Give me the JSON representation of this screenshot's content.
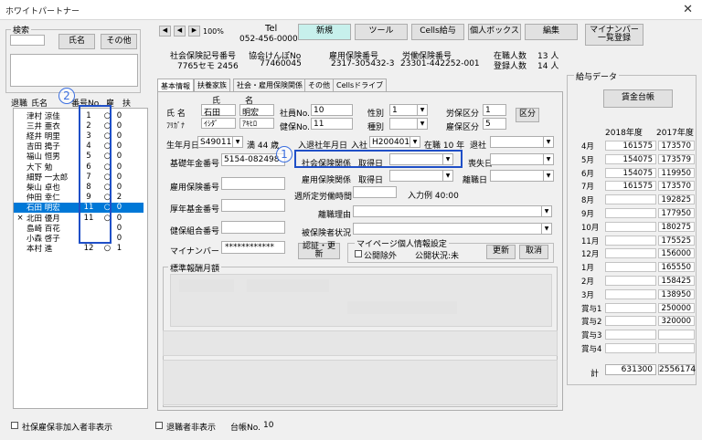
{
  "window": {
    "title": "ホワイトパートナー"
  },
  "search": {
    "label": "検索",
    "name_btn": "氏名",
    "other_btn": "その他"
  },
  "list": {
    "headers": [
      "退職",
      "氏名",
      "番号No.",
      "雇",
      "扶"
    ],
    "rows": [
      {
        "ret": "",
        "name": "津村 涼佳",
        "no": "1",
        "koyo": "○",
        "fu": "0"
      },
      {
        "ret": "",
        "name": "三井 亜衣",
        "no": "2",
        "koyo": "○",
        "fu": "0"
      },
      {
        "ret": "",
        "name": "経井 明里",
        "no": "3",
        "koyo": "○",
        "fu": "0"
      },
      {
        "ret": "",
        "name": "吉田 搗子",
        "no": "4",
        "koyo": "○",
        "fu": "0"
      },
      {
        "ret": "",
        "name": "福山 恒男",
        "no": "5",
        "koyo": "○",
        "fu": "0"
      },
      {
        "ret": "",
        "name": "大下 勉",
        "no": "6",
        "koyo": "○",
        "fu": "0"
      },
      {
        "ret": "",
        "name": "細野 一太郎",
        "no": "7",
        "koyo": "○",
        "fu": "0"
      },
      {
        "ret": "",
        "name": "柴山 卓也",
        "no": "8",
        "koyo": "○",
        "fu": "0"
      },
      {
        "ret": "",
        "name": "仲田 幸仁",
        "no": "9",
        "koyo": "○",
        "fu": "2"
      },
      {
        "ret": "",
        "name": "石田 明宏",
        "no": "11",
        "koyo": "○",
        "fu": "0"
      },
      {
        "ret": "×",
        "name": "北田 優月",
        "no": "11",
        "koyo": "○",
        "fu": "0"
      },
      {
        "ret": "",
        "name": "島崎 百花",
        "no": "",
        "koyo": "",
        "fu": "0"
      },
      {
        "ret": "",
        "name": "小森 啓子",
        "no": "",
        "koyo": "",
        "fu": "0"
      },
      {
        "ret": "",
        "name": "本村 進",
        "no": "12",
        "koyo": "○",
        "fu": "1"
      }
    ],
    "selected_index": 9
  },
  "bottom": {
    "hide_label": "社保雇保非加入者非表示",
    "retiree_label": "退職者非表示",
    "count_label": "台帳No.",
    "count_value": "10"
  },
  "nav": {
    "zoom": "100%",
    "tel_label": "Tel",
    "tel": "052-456-0000"
  },
  "toolbar": {
    "new": "新規",
    "tool": "ツール",
    "cells_pay": "Cells給与",
    "personal_box": "個人ボックス",
    "edit": "編集",
    "mynumber": "マイナンバー\n一覧登録"
  },
  "company": {
    "shakai_label": "社会保険記号番号",
    "shakai": "7765セモ 2456",
    "kenpo_label": "協会けんぽNo",
    "kenpo": "77460045",
    "koyo_label": "雇用保険番号",
    "koyo": "2317-305432-3",
    "rodo_label": "労働保険番号",
    "rodo": "23301-442252-001",
    "zaishoku_label": "在職人数",
    "zaishoku": "13 人",
    "toroku_label": "登録人数",
    "toroku": "14 人"
  },
  "tabs": [
    "基本情報",
    "扶養家族",
    "社会・雇用保険関係",
    "その他",
    "Cellsドライブ"
  ],
  "form": {
    "shi": "氏",
    "mei": "名",
    "name_label": "氏 名",
    "last": "石田",
    "first": "明宏",
    "kana_label": "ﾌﾘｶﾞﾅ",
    "last_kana": "ｲｼﾀﾞ",
    "first_kana": "ｱｷﾋﾛ",
    "empno_label": "社員No.",
    "empno": "10",
    "kenpono_label": "健保No.",
    "kenpono": "11",
    "sex_label": "性別",
    "sex": "1",
    "shubetsu_label": "種別",
    "shubetsu": "",
    "rodo_kubun_label": "労保区分",
    "rodo_kubun": "1",
    "koyo_kubun_label": "雇保区分",
    "koyo_kubun": "5",
    "kubun_btn": "区分",
    "birth_label": "生年月日",
    "birth": "S490110",
    "age": "満 44 歳",
    "join_label": "入退社年月日",
    "join_sub": "入社",
    "join": "H200401",
    "tenure": "在職 10 年",
    "taisha_label": "退社",
    "kiso_label": "基礎年金番号",
    "kiso": "5154-082498",
    "shakai_rel_label": "社会保険関係",
    "shutoku": "取得日",
    "soshitsu": "喪失日",
    "koyo_rel_label": "雇用保険関係",
    "shutoku2": "取得日",
    "rishoku": "離職日",
    "koyo_no_label": "雇用保険番号",
    "kosei_label": "厚年基金番号",
    "weekly_label": "週所定労働時間",
    "input_ex": "入力例 40:00",
    "rishoku_reason_label": "離職理由",
    "hihoken_label": "被保険者状況",
    "kenpo_kumiai_label": "健保組合番号",
    "mynumber_label": "マイナンバー",
    "mynumber": "************",
    "ninsho_btn": "認証・更新",
    "mypage_label": "マイページ個人情報設定",
    "public_exclude": "公開除外",
    "public_status": "公開状況:未",
    "update_btn": "更新",
    "cancel_btn": "取消",
    "hyojun_label": "標準報酬月額"
  },
  "salary": {
    "title": "給与データ",
    "ledger_btn": "賃金台帳",
    "year1": "2018年度",
    "year2": "2017年度",
    "rows": [
      {
        "m": "4月",
        "a": "161575",
        "b": "173570"
      },
      {
        "m": "5月",
        "a": "154075",
        "b": "173579"
      },
      {
        "m": "6月",
        "a": "154075",
        "b": "119950"
      },
      {
        "m": "7月",
        "a": "161575",
        "b": "173570"
      },
      {
        "m": "8月",
        "a": "",
        "b": "192825"
      },
      {
        "m": "9月",
        "a": "",
        "b": "177950"
      },
      {
        "m": "10月",
        "a": "",
        "b": "180275"
      },
      {
        "m": "11月",
        "a": "",
        "b": "175525"
      },
      {
        "m": "12月",
        "a": "",
        "b": "156000"
      },
      {
        "m": "1月",
        "a": "",
        "b": "165550"
      },
      {
        "m": "2月",
        "a": "",
        "b": "158425"
      },
      {
        "m": "3月",
        "a": "",
        "b": "138950"
      },
      {
        "m": "賞与1",
        "a": "",
        "b": "250000"
      },
      {
        "m": "賞与2",
        "a": "",
        "b": "320000"
      },
      {
        "m": "賞与3",
        "a": "",
        "b": ""
      },
      {
        "m": "賞与4",
        "a": "",
        "b": ""
      }
    ],
    "total_label": "計",
    "total_a": "631300",
    "total_b": "2556174"
  },
  "annotations": [
    "1",
    "2"
  ]
}
